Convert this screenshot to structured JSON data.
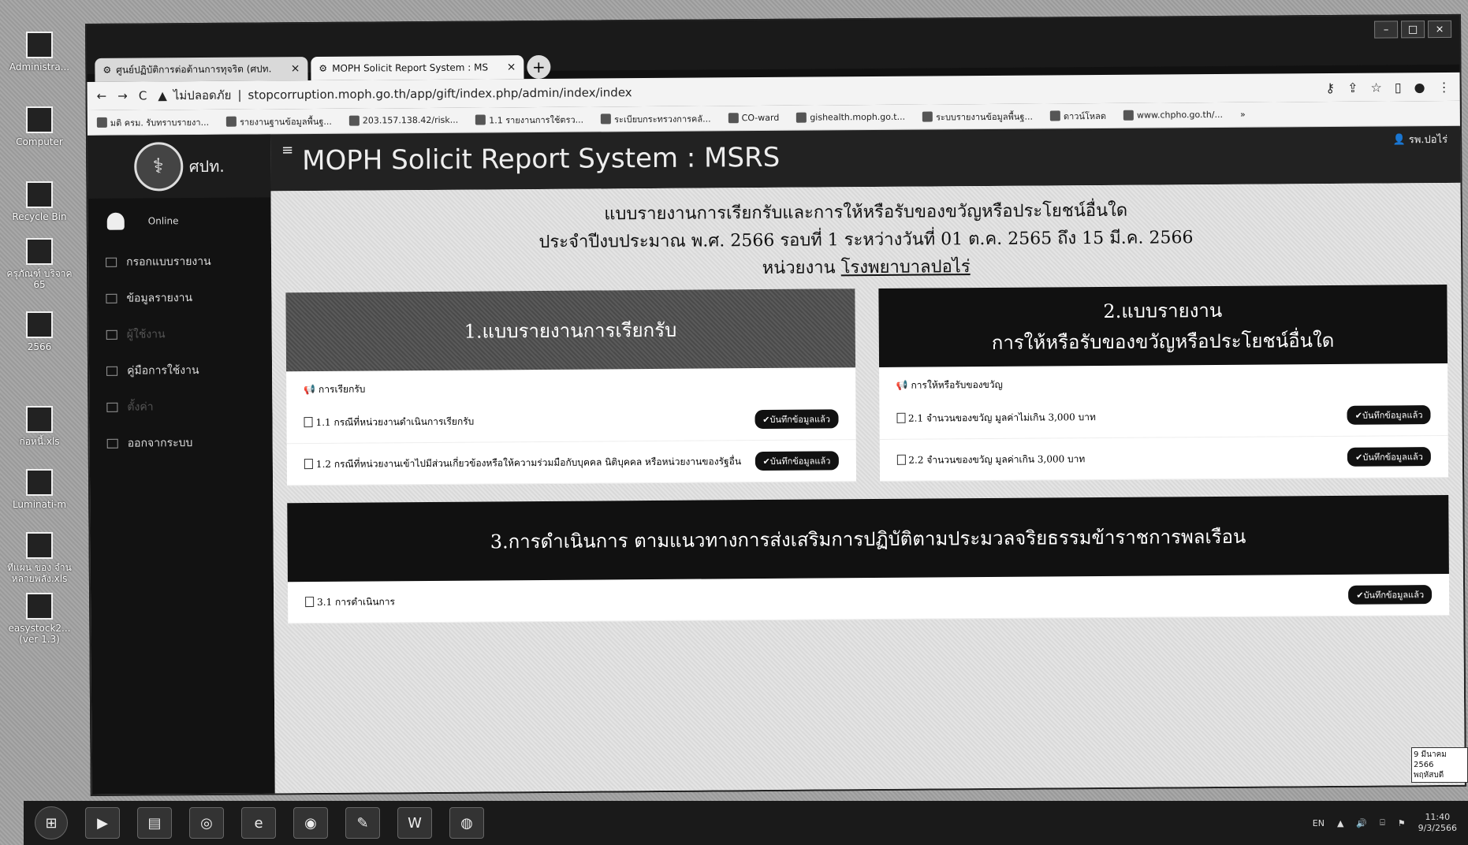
{
  "desktop": {
    "icons": [
      {
        "label": "Administra..."
      },
      {
        "label": "Computer"
      },
      {
        "label": "Recycle Bin"
      },
      {
        "label": "ครุภัณฑ์ บริจาค 65"
      },
      {
        "label": "2566"
      },
      {
        "label": "ก่อหนี้.xls"
      },
      {
        "label": "Luminati-m"
      },
      {
        "label": "ทีแผน ของ จำนหลายพลัง.xls"
      },
      {
        "label": "easystock2... (ver 1.3)"
      }
    ]
  },
  "browser": {
    "tabs": [
      {
        "label": "ศูนย์ปฏิบัติการต่อต้านการทุจริต (ศปท.",
        "close": "×"
      },
      {
        "label": "MOPH Solicit Report System : MS",
        "close": "×"
      }
    ],
    "new_tab": "+",
    "window_controls": [
      "–",
      "□",
      "×"
    ],
    "address": {
      "security_label": "ไม่ปลอดภัย",
      "url": "stopcorruption.moph.go.th/app/gift/index.php/admin/index/index"
    },
    "bookmarks": [
      "มติ ครม. รับทราบรายงา...",
      "รายงานฐานข้อมูลพื้นฐ...",
      "203.157.138.42/risk...",
      "1.1 รายงานการใช้ตรว...",
      "ระเบียบกระทรวงการคลั...",
      "CO-ward",
      "gishealth.moph.go.t...",
      "ระบบรายงานข้อมูลพื้นฐ...",
      "ดาวน์โหลด",
      "www.chpho.go.th/..."
    ],
    "bookmarks_more": "»"
  },
  "sidebar": {
    "brand": "ศปท.",
    "status": "Online",
    "menu": [
      {
        "label": "กรอกแบบรายงาน",
        "dim": false
      },
      {
        "label": "ข้อมูลรายงาน",
        "dim": false
      },
      {
        "label": "ผู้ใช้งาน",
        "dim": true
      },
      {
        "label": "คู่มือการใช้งาน",
        "dim": false
      },
      {
        "label": "ตั้งค่า",
        "dim": true
      },
      {
        "label": "ออกจากระบบ",
        "dim": false
      }
    ]
  },
  "header": {
    "title": "MOPH Solicit Report System : MSRS",
    "user": "รพ.ปอไร่"
  },
  "report": {
    "line1": "แบบรายงานการเรียกรับและการให้หรือรับของขวัญหรือประโยชน์อื่นใด",
    "line2": "ประจำปีงบประมาณ พ.ศ. 2566 รอบที่ 1 ระหว่างวันที่ 01 ต.ค. 2565 ถึง 15 มี.ค. 2566",
    "line3_prefix": "หน่วยงาน",
    "unit": "โรงพยาบาลปอไร่"
  },
  "card1": {
    "title": "1.แบบรายงานการเรียกรับ",
    "section": "การเรียกรับ",
    "items": [
      {
        "label": "1.1 กรณีที่หน่วยงานดำเนินการเรียกรับ",
        "badge": "✔บันทึกข้อมูลแล้ว"
      },
      {
        "label": "1.2 กรณีที่หน่วยงานเข้าไปมีส่วนเกี่ยวข้องหรือให้ความร่วมมือกับบุคคล นิติบุคคล หรือหน่วยงานของรัฐอื่น",
        "badge": "✔บันทึกข้อมูลแล้ว"
      }
    ]
  },
  "card2": {
    "title_line1": "2.แบบรายงาน",
    "title_line2": "การให้หรือรับของขวัญหรือประโยชน์อื่นใด",
    "section": "การให้หรือรับของขวัญ",
    "items": [
      {
        "label": "2.1 จำนวนของขวัญ มูลค่าไม่เกิน 3,000 บาท",
        "badge": "✔บันทึกข้อมูลแล้ว"
      },
      {
        "label": "2.2 จำนวนของขวัญ มูลค่าเกิน 3,000 บาท",
        "badge": "✔บันทึกข้อมูลแล้ว"
      }
    ]
  },
  "card3": {
    "title": "3.การดำเนินการ ตามแนวทางการส่งเสริมการปฏิบัติตามประมวลจริยธรรมข้าราชการพลเรือน",
    "items": [
      {
        "label": "3.1 การดำเนินการ",
        "badge": "✔บันทึกข้อมูลแล้ว"
      }
    ]
  },
  "taskbar": {
    "lang": "EN",
    "time": "11:40",
    "date": "9/3/2566",
    "note_line1": "9 มีนาคม 2566",
    "note_line2": "พฤหัสบดี"
  }
}
